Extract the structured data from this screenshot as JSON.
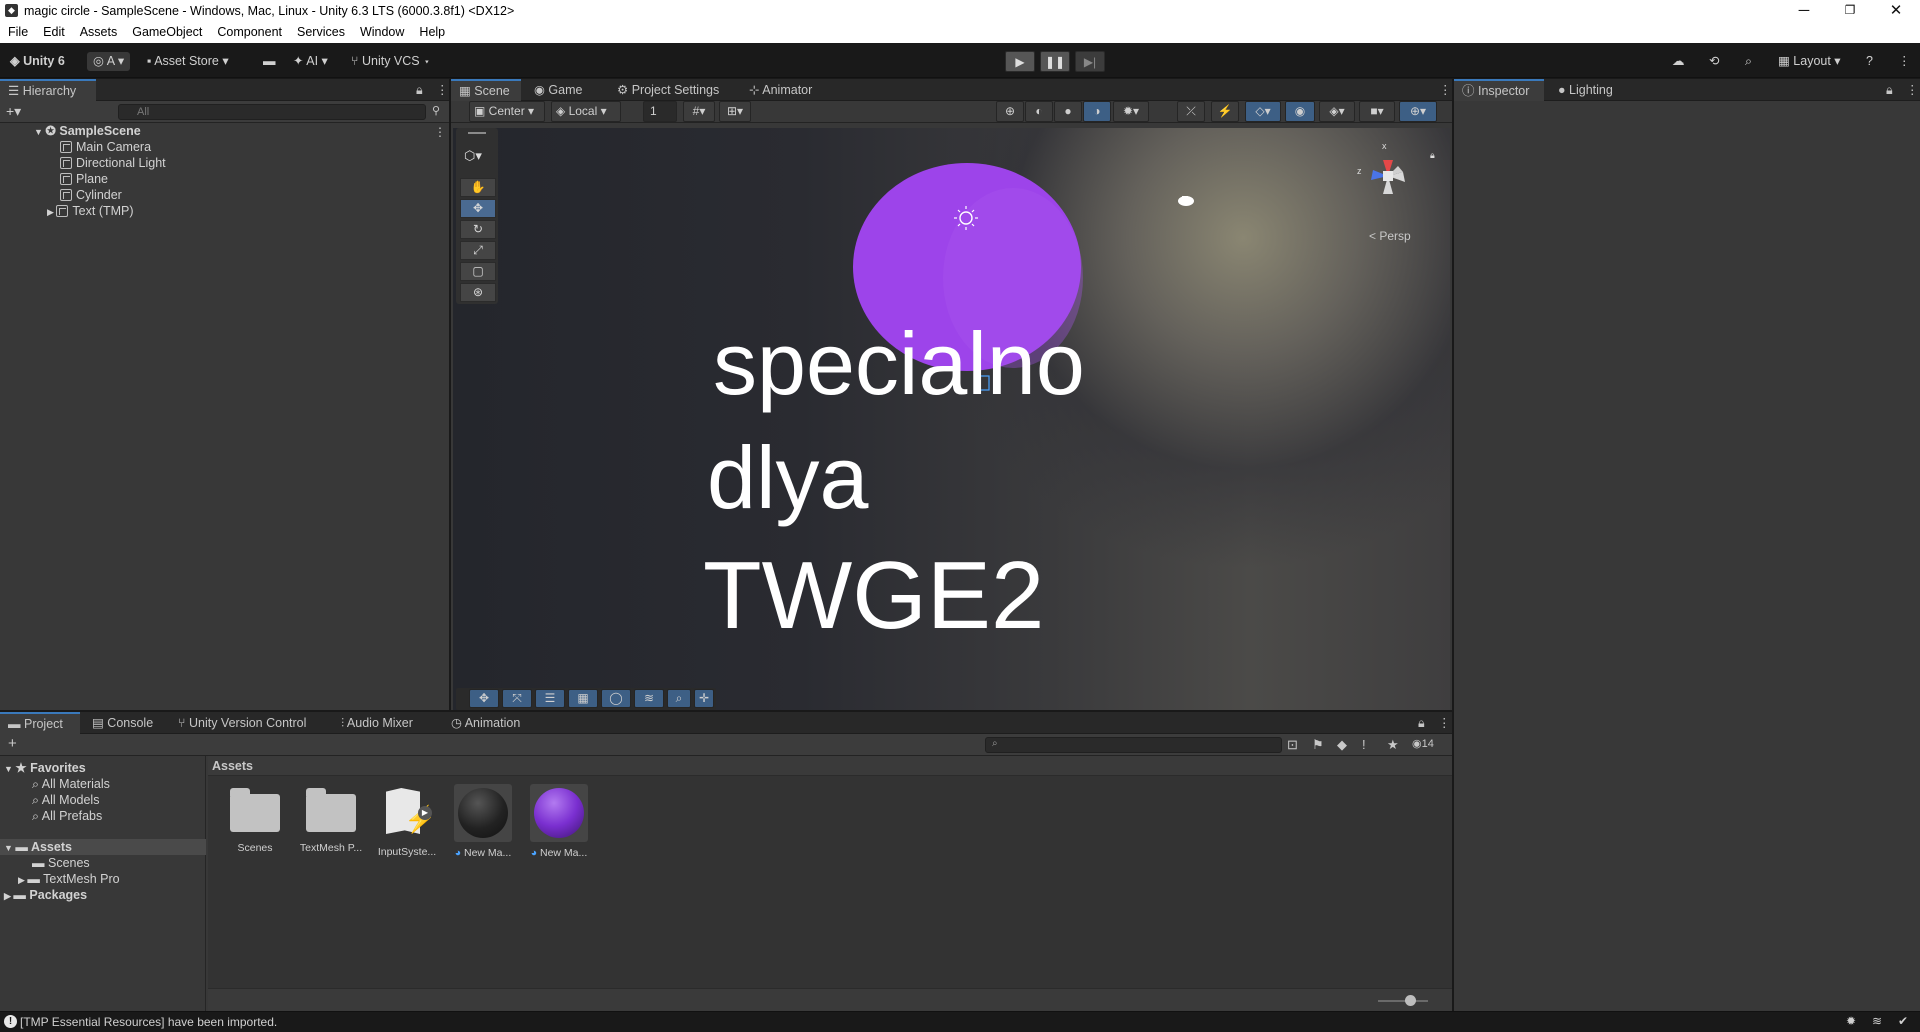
{
  "window": {
    "title": "magic circle - SampleScene - Windows, Mac, Linux - Unity 6.3 LTS (6000.3.8f1) <DX12>",
    "minimize": "─",
    "maximize": "❐",
    "close": "✕"
  },
  "menu": [
    "File",
    "Edit",
    "Assets",
    "GameObject",
    "Component",
    "Services",
    "Window",
    "Help"
  ],
  "toolbar": {
    "unity_label": "Unity 6",
    "account_label": "A",
    "asset_store_label": "Asset Store",
    "ai_label": "AI",
    "vcs_label": "Unity VCS",
    "layout_label": "Layout"
  },
  "hierarchy": {
    "tab_label": "Hierarchy",
    "search_placeholder": "All",
    "scene_name": "SampleScene",
    "items": [
      "Main Camera",
      "Directional Light",
      "Plane",
      "Cylinder",
      "Text (TMP)"
    ]
  },
  "center_tabs": [
    "Scene",
    "Game",
    "Project Settings",
    "Animator"
  ],
  "scene_toolbar": {
    "pivot_label": "Center",
    "space_label": "Local",
    "grid_value": "1"
  },
  "scene_view": {
    "text_lines": [
      "specialno",
      "dlya",
      "TWGE2"
    ],
    "circle_color": "#9d44ea",
    "gizmo_label": "< Persp",
    "gizmo_x": "x",
    "gizmo_z": "z"
  },
  "right_tabs": [
    "Inspector",
    "Lighting"
  ],
  "bottom_tabs": [
    "Project",
    "Console",
    "Unity Version Control",
    "Audio Mixer",
    "Animation"
  ],
  "project": {
    "search_placeholder": "",
    "hidden_count": "14",
    "favorites_label": "Favorites",
    "favorites": [
      "All Materials",
      "All Models",
      "All Prefabs"
    ],
    "assets_label": "Assets",
    "asset_folders": [
      "Scenes",
      "TextMesh Pro"
    ],
    "packages_label": "Packages",
    "breadcrumb": "Assets",
    "grid_items": [
      "Scenes",
      "TextMesh P...",
      "InputSyste...",
      "New Ma...",
      "New Ma..."
    ]
  },
  "status": {
    "message": "[TMP Essential Resources] have been imported."
  }
}
